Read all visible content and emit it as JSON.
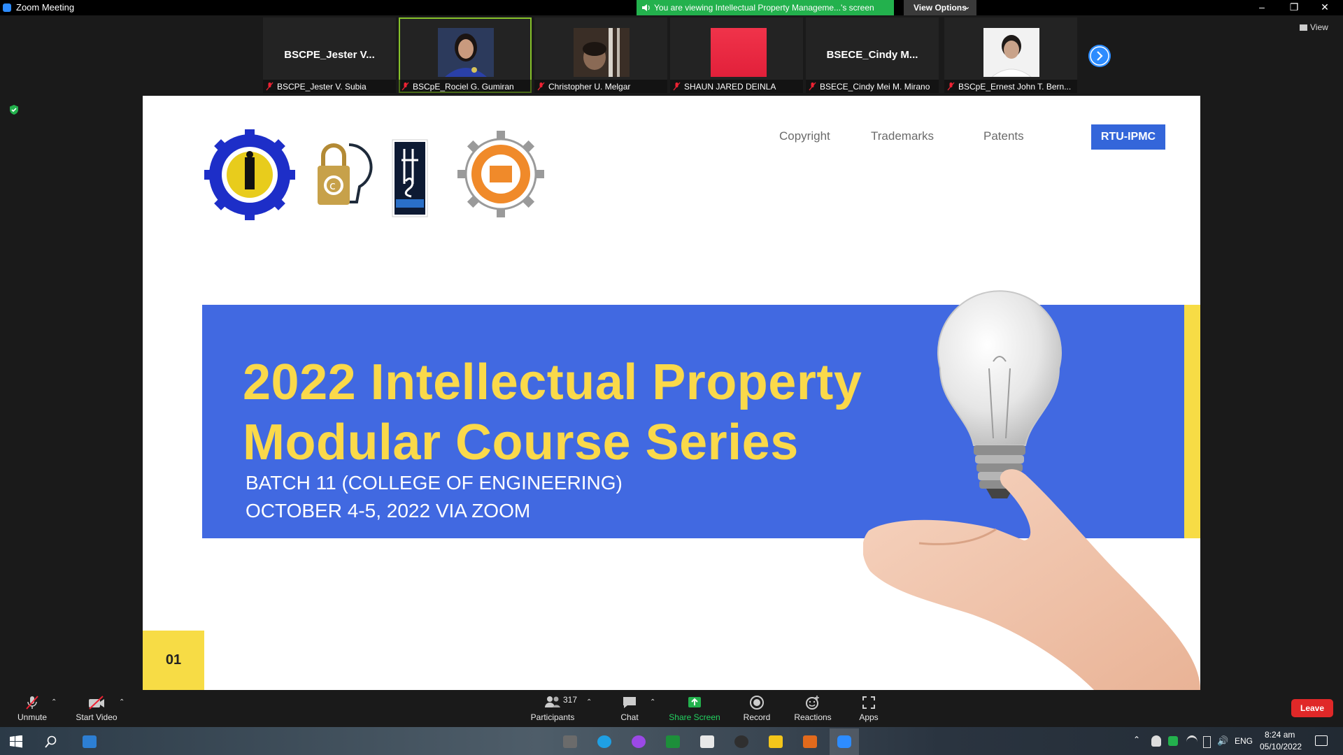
{
  "window": {
    "title": "Zoom Meeting"
  },
  "share_banner": "You are viewing Intellectual Property Manageme...'s screen",
  "view_options": "View Options",
  "view_button": "View",
  "participants": [
    {
      "tile_text": "BSCPE_Jester  V...",
      "label": "BSCPE_Jester V. Subia"
    },
    {
      "tile_text": "",
      "label": "BSCpE_Rociel G. Gumiran"
    },
    {
      "tile_text": "",
      "label": "Christopher U. Melgar"
    },
    {
      "tile_text": "",
      "label": "SHAUN JARED DEINLA"
    },
    {
      "tile_text": "BSECE_Cindy  M...",
      "label": "BSECE_Cindy Mei M. Mirano"
    },
    {
      "tile_text": "",
      "label": "BSCpE_Ernest John T. Bern..."
    }
  ],
  "slide": {
    "nav": [
      "Copyright",
      "Trademarks",
      "Patents"
    ],
    "cta": "RTU-IPMC",
    "headline_1": "2022 Intellectual Property",
    "headline_2": "Modular Course Series",
    "sub_1": "BATCH 11 (COLLEGE OF ENGINEERING)",
    "sub_2": "OCTOBER 4-5, 2022 VIA ZOOM",
    "page_number": "01",
    "logos": [
      "rtu-seal",
      "copyright-lightbulb",
      "franchise-logo",
      "engineering-gear-logo"
    ]
  },
  "toolbar": {
    "unmute": "Unmute",
    "start_video": "Start Video",
    "participants": "Participants",
    "participant_count": "317",
    "chat": "Chat",
    "share_screen": "Share Screen",
    "record": "Record",
    "reactions": "Reactions",
    "apps": "Apps",
    "leave": "Leave"
  },
  "taskbar": {
    "language": "ENG",
    "time": "8:24 am",
    "date": "05/10/2022"
  },
  "colors": {
    "share_green": "#23b14d",
    "zoom_blue": "#2d8cff",
    "slide_blue": "#4169e1",
    "slide_yellow": "#fad94a",
    "leave_red": "#e02828"
  }
}
